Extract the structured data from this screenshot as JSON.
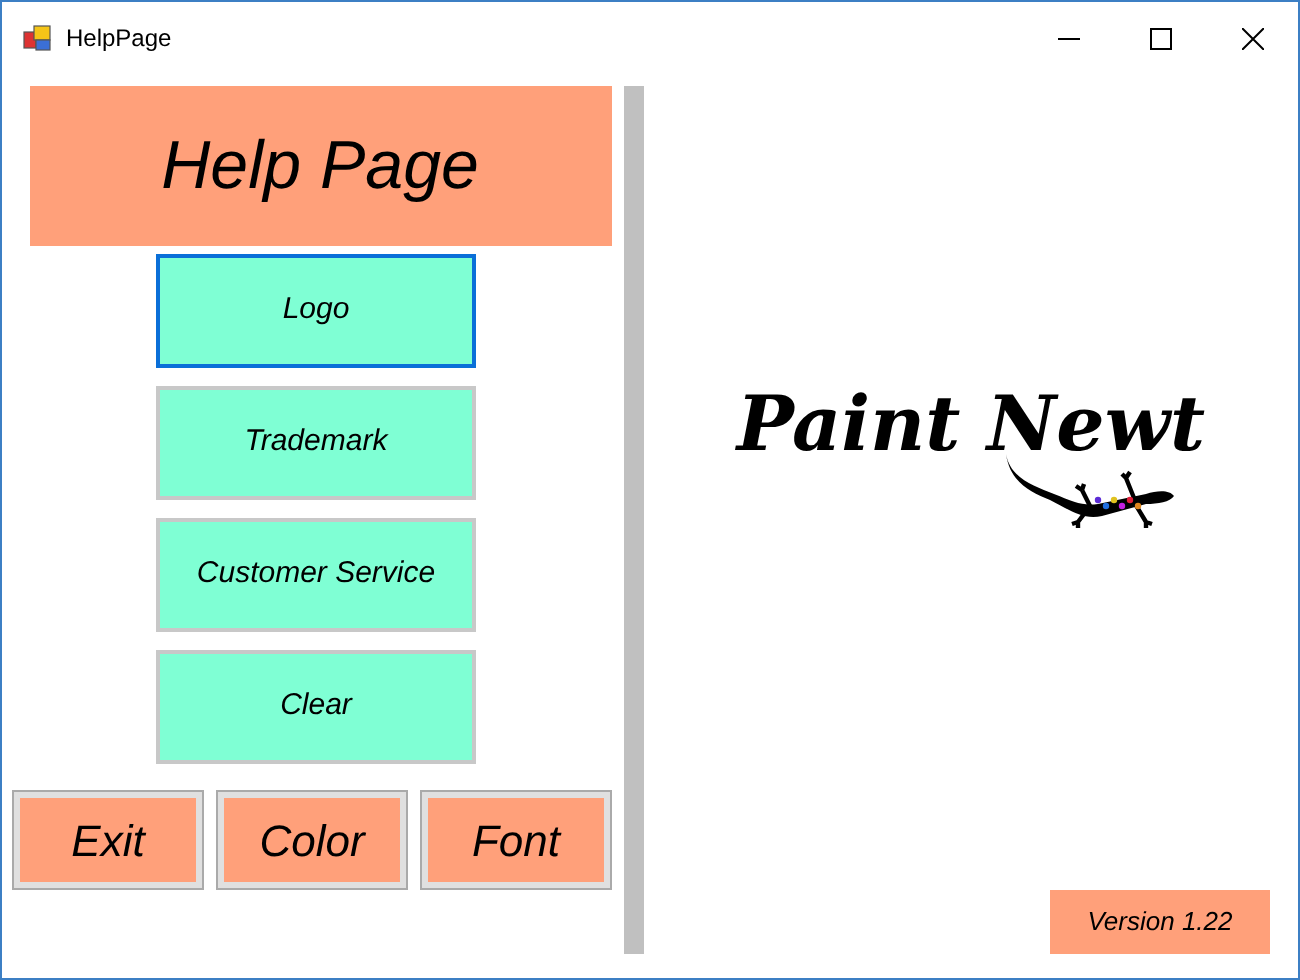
{
  "window": {
    "title": "HelpPage"
  },
  "header": "Help Page",
  "menu_buttons": [
    {
      "label": "Logo",
      "selected": true
    },
    {
      "label": "Trademark",
      "selected": false
    },
    {
      "label": "Customer Service",
      "selected": false
    },
    {
      "label": "Clear",
      "selected": false
    }
  ],
  "bottom_buttons": [
    "Exit",
    "Color",
    "Font"
  ],
  "logo": {
    "text": "Paint Newt"
  },
  "version": "Version 1.22"
}
